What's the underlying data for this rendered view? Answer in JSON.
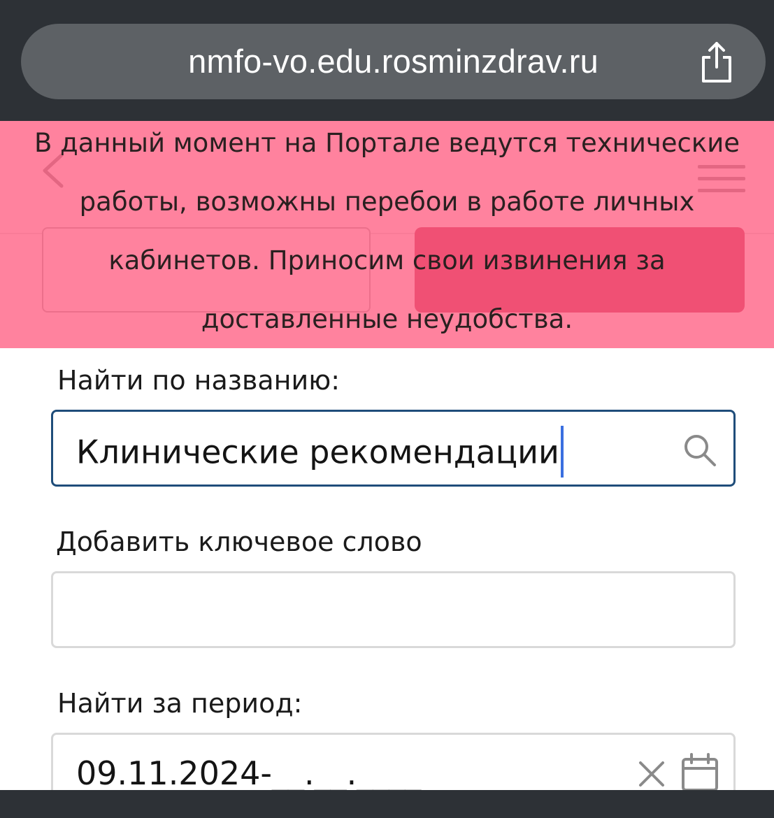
{
  "browser": {
    "url": "nmfo-vo.edu.rosminzdrav.ru",
    "share_icon": "share-icon"
  },
  "header": {
    "back_icon": "chevron-left-icon",
    "menu_icon": "hamburger-menu-icon"
  },
  "banner": {
    "text": "В данный момент на Портале ведутся технические работы, возможны перебои в работе личных кабинетов. Приносим свои извинения за доставленные неудобства.",
    "background_color": "#ff5278"
  },
  "form": {
    "search_label": "Найти по названию:",
    "search_value": "Клинические рекомендации",
    "search_icon": "search-icon",
    "keyword_label": "Добавить ключевое слово",
    "keyword_value": "",
    "period_label": "Найти за период:",
    "period_value": "09.11.2024-__.__.____",
    "clear_icon": "close-icon",
    "calendar_icon": "calendar-icon"
  },
  "colors": {
    "accent": "#1f4d7a",
    "caret": "#3a6fe0",
    "browser_chrome": "#2d3136"
  }
}
